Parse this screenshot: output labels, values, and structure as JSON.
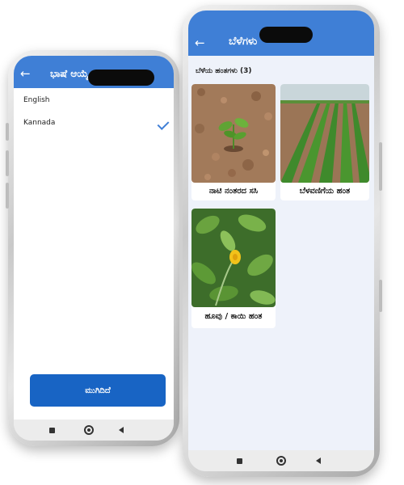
{
  "left_screen": {
    "title": "ಭಾಷೆ ಆಯ್ಕೆ ಮಾಡಿ",
    "languages": [
      {
        "label": "English",
        "selected": false
      },
      {
        "label": "Kannada",
        "selected": true
      }
    ],
    "done_button": "ಮುಗಿದಿದೆ"
  },
  "right_screen": {
    "title": "ಬೆಳೆಗಳು",
    "section_label": "ಬೆಳೆಯ ಹಂತಗಳು (3)",
    "stages": [
      {
        "label": "ನಾಟಿ ನಂತರದ ಸಸಿ",
        "image": "seedling-soil"
      },
      {
        "label": "ಬೆಳವಣಿಗೆಯ ಹಂತ",
        "image": "crop-rows-field"
      },
      {
        "label": "ಹೂವು / ಕಾಯಿ ಹಂತ",
        "image": "yellow-flower-plant"
      }
    ]
  },
  "colors": {
    "app_bar": "#3f7fd6",
    "primary_button": "#1864c4",
    "check": "#3f7fd6",
    "screen_bg": "#eef2fa"
  }
}
